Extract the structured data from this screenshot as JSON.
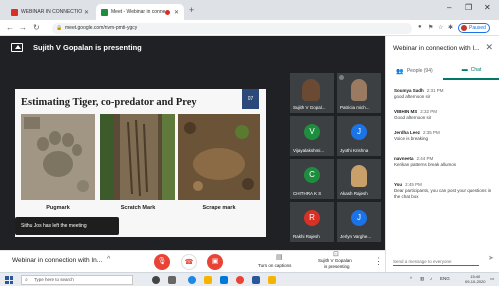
{
  "browser": {
    "tabs": [
      {
        "label": "WEBINAR IN CONNECTION WIT",
        "favicon_color": "#d93025"
      },
      {
        "label": "Meet - Webinar in connecti",
        "favicon_color": "#1e8e3e",
        "recording": true
      }
    ],
    "new_tab": "+",
    "window_controls": {
      "minimize": "–",
      "restore": "❐",
      "close": "✕"
    },
    "url": "meet.google.com/nvm-pmti-ygcy",
    "paused_label": "Paused"
  },
  "meeting": {
    "presenting_text": "Sujith V Gopalan is presenting",
    "slide": {
      "title": "Estimating Tiger, co-predator and Prey",
      "number": "07",
      "captions": [
        "Pugmark",
        "Scratch Mark",
        "Scrape mark"
      ]
    },
    "toast": "Sithu Jos has left the meeting",
    "participants": [
      {
        "name": "Sujith V Gopal...",
        "initial": "",
        "color": "#3c4043",
        "video": true
      },
      {
        "name": "Patricia mich...",
        "initial": "",
        "color": "#3c4043",
        "video": true
      },
      {
        "name": "Vijayalakshmi...",
        "initial": "V",
        "color": "#1e8e3e"
      },
      {
        "name": "Jyothi Krishna",
        "initial": "J",
        "color": "#1a73e8"
      },
      {
        "name": "CHITHRA K S",
        "initial": "C",
        "color": "#1e8e3e"
      },
      {
        "name": "Akash Rajesh",
        "initial": "",
        "color": "#3c4043",
        "video": true
      },
      {
        "name": "Rakhi Rajesh",
        "initial": "R",
        "color": "#d93025"
      },
      {
        "name": "Jerlyn Varghe...",
        "initial": "J",
        "color": "#1a73e8"
      }
    ]
  },
  "bottombar": {
    "meeting_title": "Webinar in connection with In...",
    "captions_label": "Turn on captions",
    "presenting_label_1": "Sujith V Gopalan",
    "presenting_label_2": "is presenting"
  },
  "panel": {
    "title": "Webinar in connection with I...",
    "tabs": {
      "people": "People (94)",
      "chat": "Chat"
    },
    "messages": [
      {
        "sender": "Soumya Sadh",
        "time": "2:31 PM",
        "text": "good afternoon sir"
      },
      {
        "sender": "VIBHIN MS",
        "time": "2:32 PM",
        "text": "Good afternoon sir"
      },
      {
        "sender": "Jerdha Leez",
        "time": "2:35 PM",
        "text": "Voice is breaking"
      },
      {
        "sender": "navneeta",
        "time": "2:44 PM",
        "text": "Kerikan patterns break allumos"
      },
      {
        "sender": "You",
        "time": "2:45 PM",
        "text": "Dear participants, you can post your questions in the chat box"
      }
    ],
    "input_placeholder": "Send a message to everyone"
  },
  "taskbar": {
    "search_placeholder": "Type here to search",
    "language": "ENG",
    "time": "15:40",
    "date": "09-10-2020"
  }
}
